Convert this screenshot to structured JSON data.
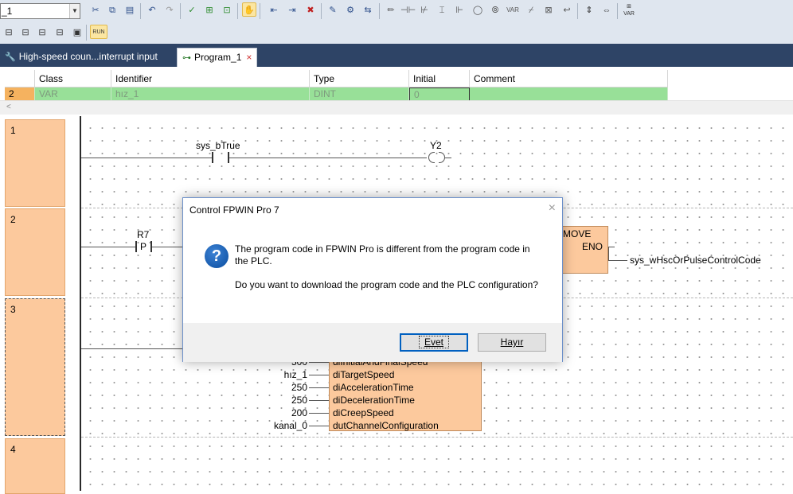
{
  "toolbar": {
    "combo_value": "_1",
    "combo_arrow": "▼",
    "row1_icons": [
      "cut-icon",
      "copy-icon",
      "paste-icon",
      "undo-icon",
      "redo-icon",
      "compile-icon",
      "network-icon",
      "monitor-icon",
      "hand-icon",
      "insert-icon",
      "append-icon",
      "delete-icon",
      "edit-icon",
      "build-icon",
      "online-icon",
      "pen-icon",
      "contact-icon",
      "contact-nc-icon",
      "coil-icon",
      "coil-set-icon",
      "function-icon",
      "box-icon",
      "var-icon",
      "pulse-icon",
      "jump-icon",
      "return-icon",
      "insert-row-icon",
      "insert-col-icon",
      "var-list-icon"
    ],
    "row2_icons": [
      "ld-icon",
      "fbd-icon",
      "sfc-icon",
      "st-icon",
      "monitor-plc-icon",
      "run-icon"
    ],
    "run_label": "RUN",
    "var_label": "VAR"
  },
  "tabs": [
    {
      "label": "High-speed coun...interrupt input",
      "icon": "wrench-icon"
    },
    {
      "label": "Program_1",
      "icon": "program-icon",
      "close": "×"
    }
  ],
  "grid": {
    "headers": [
      "Class",
      "Identifier",
      "Type",
      "Initial",
      "Comment"
    ],
    "row": {
      "num": "2",
      "class": "VAR",
      "identifier": "hız_1",
      "type": "DINT",
      "initial": "0",
      "comment": ""
    },
    "scroll_left": "<"
  },
  "networks": [
    {
      "num": "1"
    },
    {
      "num": "2"
    },
    {
      "num": "3"
    },
    {
      "num": "4"
    }
  ],
  "ladder": {
    "n1_contact": "sys_bTrue",
    "n1_coil": "Y2",
    "n2_contact": "R7",
    "n2_contact_type": "P",
    "n2_move": "MOVE",
    "n2_eno": "ENO",
    "n2_output": "sys_wHscOrPulseControlCode",
    "n3_inputs": [
      {
        "value": "500",
        "pin": "diInitialAndFinalSpeed"
      },
      {
        "value": "hız_1",
        "pin": "diTargetSpeed"
      },
      {
        "value": "250",
        "pin": "diAccelerationTime"
      },
      {
        "value": "250",
        "pin": "diDecelerationTime"
      },
      {
        "value": "200",
        "pin": "diCreepSpeed"
      },
      {
        "value": "kanal_0",
        "pin": "dutChannelConfiguration"
      }
    ]
  },
  "dialog": {
    "title": "Control FPWIN Pro 7",
    "close": "×",
    "icon": "question-icon",
    "icon_glyph": "?",
    "message1": "The program code in FPWIN Pro is different from the program code in the PLC.",
    "message2": "Do you want to download the program code and the PLC configuration?",
    "yes_label": "Evet",
    "no_label": "Hayır"
  },
  "colors": {
    "toolbar_bg": "#dfe6ef",
    "tabstrip_bg": "#2e4466",
    "grid_row": "#98e098",
    "network_bg": "#fcc99d",
    "accent": "#0060c0"
  }
}
